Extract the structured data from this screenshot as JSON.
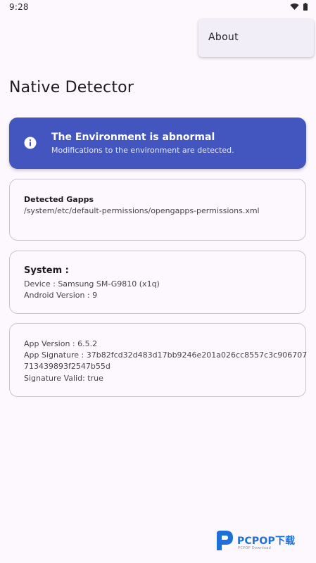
{
  "status_bar": {
    "time": "9:28",
    "icons": [
      "wifi-icon",
      "battery-icon"
    ]
  },
  "menu": {
    "about_label": "About"
  },
  "header": {
    "title": "Native Detector"
  },
  "alert": {
    "icon": "info-icon",
    "title": "The Environment is abnormal",
    "subtitle": "Modifications to the environment are detected.",
    "color": "#4355BE"
  },
  "gapps_card": {
    "heading": "Detected Gapps",
    "path": "/system/etc/default-permissions/opengapps-permissions.xml"
  },
  "system_card": {
    "heading": "System :",
    "device": "Device : Samsung SM-G9810  (x1q)",
    "android_version": "Android Version : 9"
  },
  "app_card": {
    "app_version": "App Version : 6.5.2",
    "signature_line1": "App Signature : 37b82fcd32d483d17bb9246e201a026cc8557c3c906707",
    "signature_line2": "713439893f2547b55d",
    "signature_valid": "Signature Valid: true"
  },
  "watermark": {
    "logo": "PCPOP下载",
    "sub": "PCPOP Download"
  }
}
